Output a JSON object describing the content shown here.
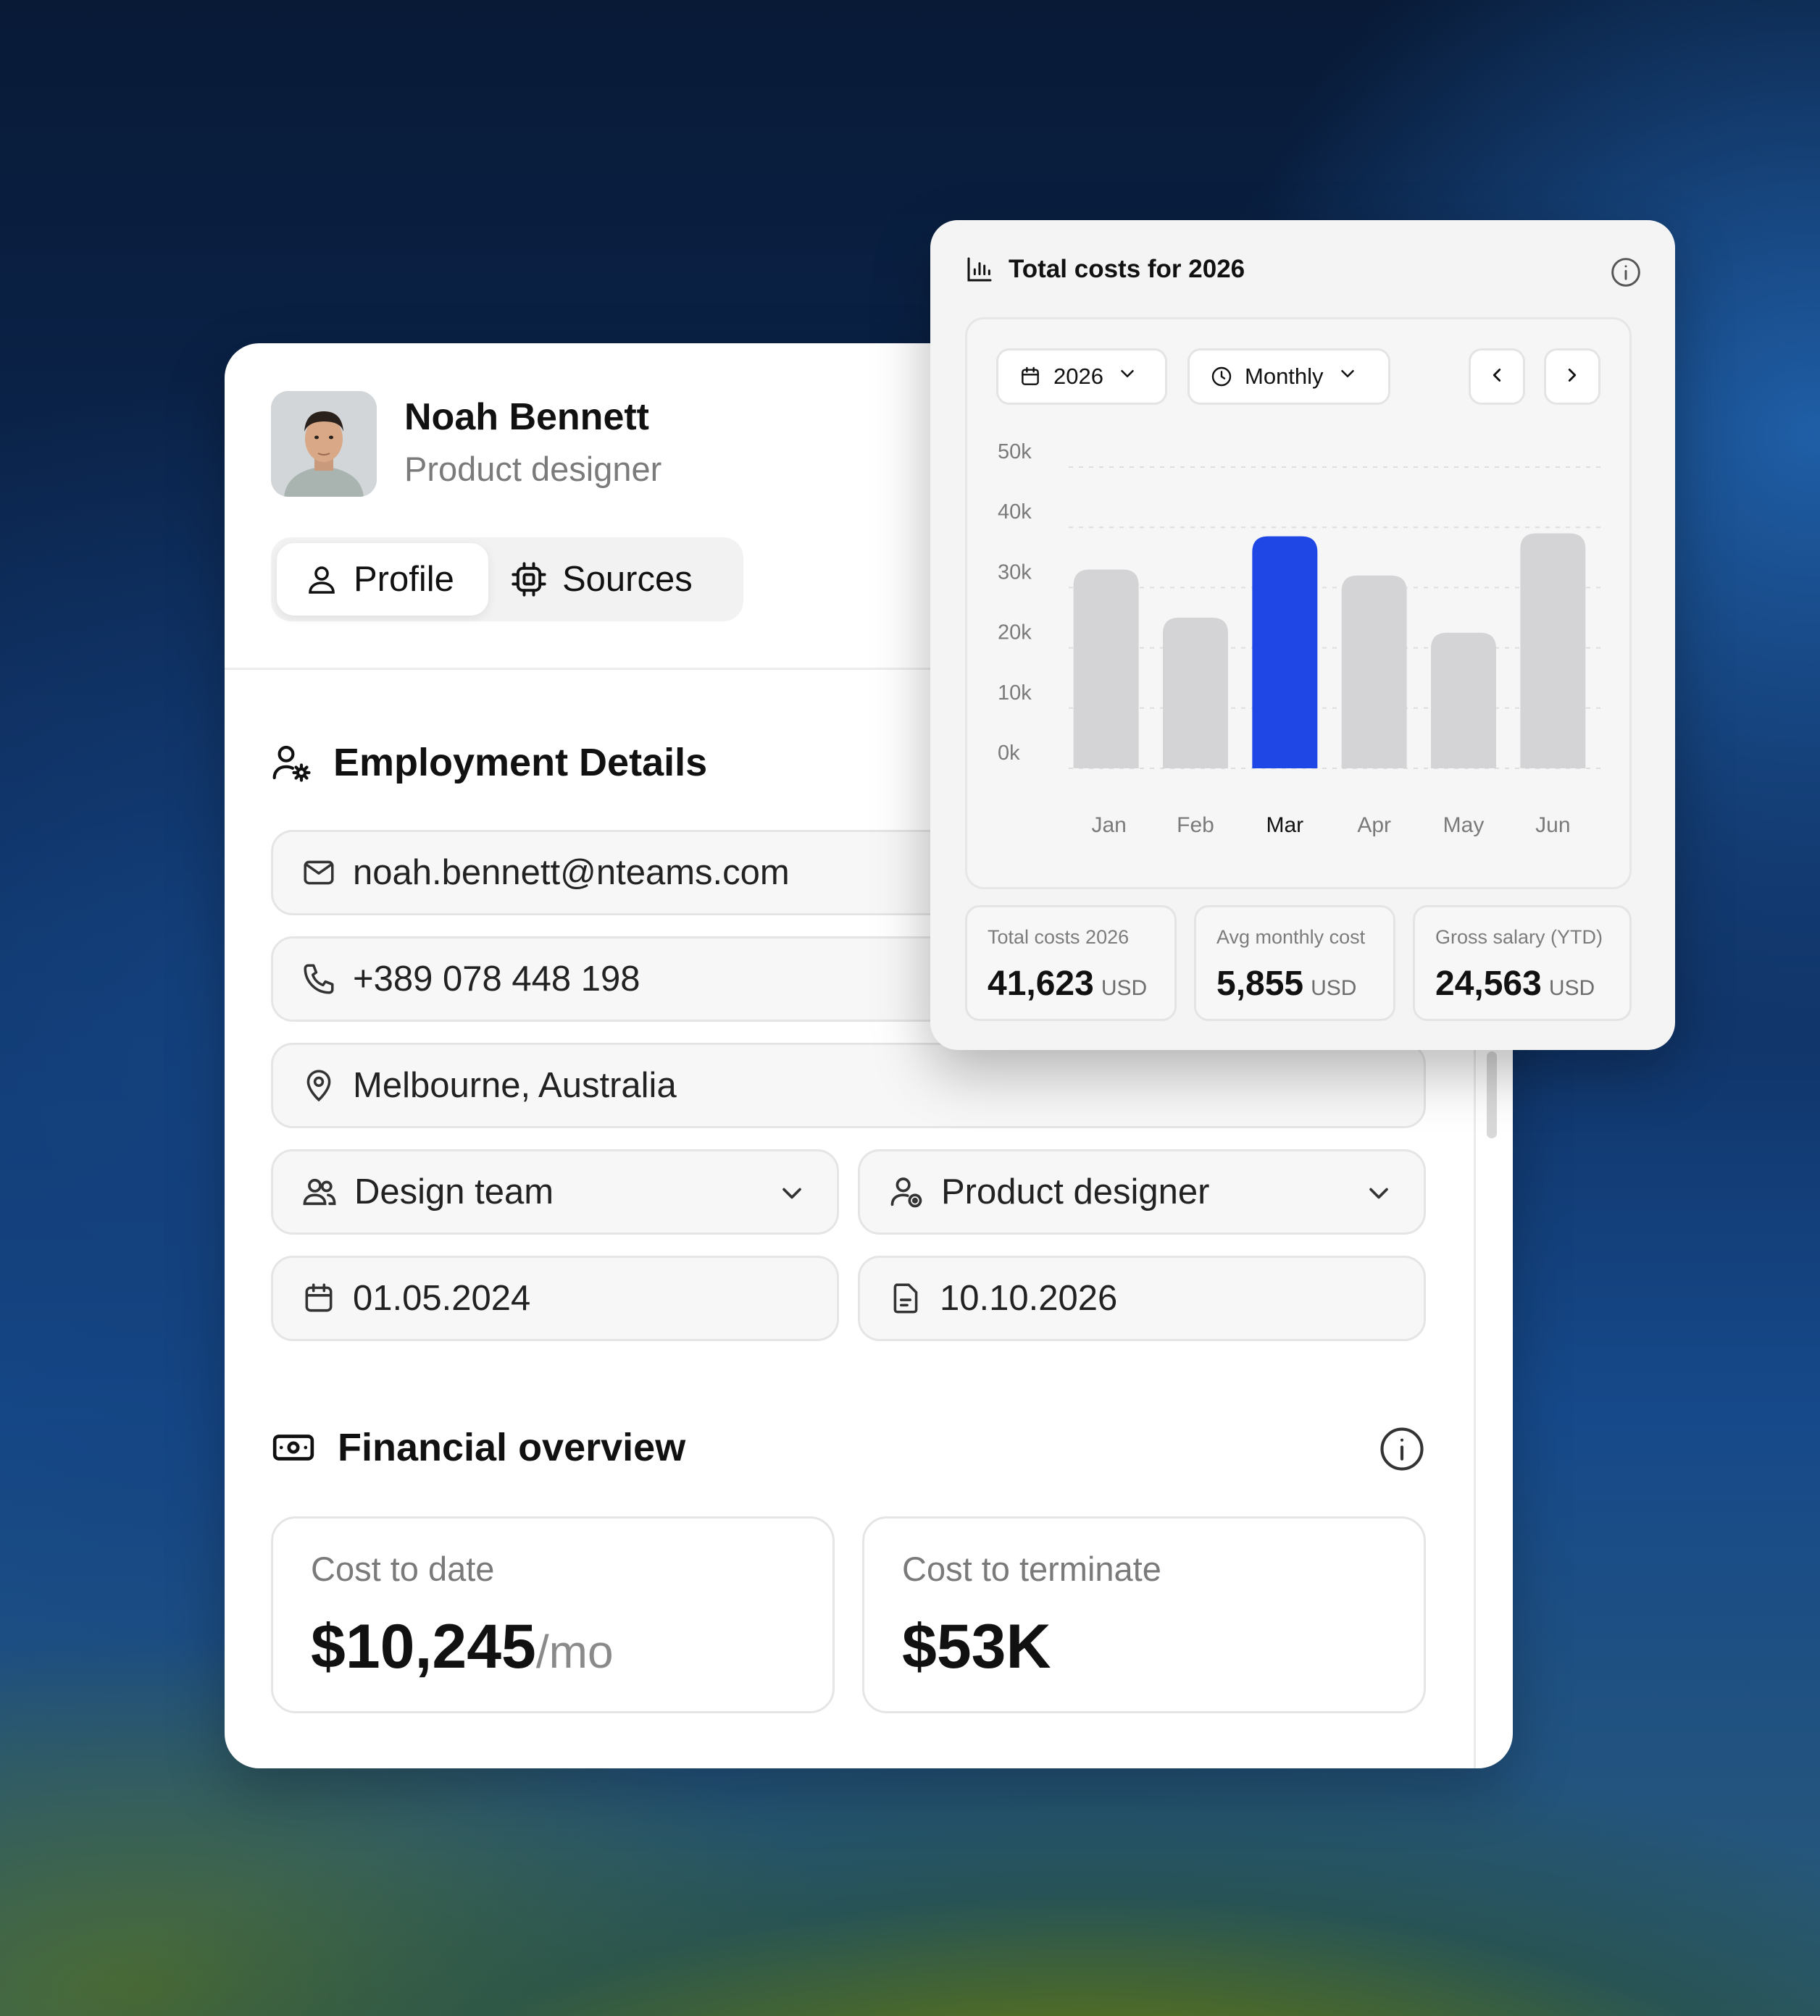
{
  "profile": {
    "name": "Noah Bennett",
    "role": "Product designer",
    "tabs": [
      {
        "label": "Profile",
        "active": true,
        "icon": "user-icon"
      },
      {
        "label": "Sources",
        "active": false,
        "icon": "chip-icon"
      }
    ]
  },
  "employment": {
    "title": "Employment Details",
    "email": "noah.bennett@nteams.com",
    "phone": "+389 078 448 198",
    "location": "Melbourne, Australia",
    "team": "Design team",
    "position": "Product designer",
    "start_date": "01.05.2024",
    "end_date": "10.10.2026"
  },
  "financial": {
    "title": "Financial overview",
    "cost_to_date": {
      "label": "Cost to date",
      "value": "$10,245",
      "suffix": "/mo"
    },
    "cost_to_terminate": {
      "label": "Cost to terminate",
      "value": "$53K"
    }
  },
  "costs_widget": {
    "title": "Total costs for 2026",
    "year_select": "2026",
    "period_select": "Monthly",
    "stats": [
      {
        "label": "Total costs 2026",
        "value": "41,623",
        "unit": "USD"
      },
      {
        "label": "Avg monthly cost",
        "value": "5,855",
        "unit": "USD"
      },
      {
        "label": "Gross salary (YTD)",
        "value": "24,563",
        "unit": "USD"
      }
    ]
  },
  "colors": {
    "accent": "#1f47e6",
    "bar": "#d4d4d6"
  },
  "chart_data": {
    "type": "bar",
    "categories": [
      "Jan",
      "Feb",
      "Mar",
      "Apr",
      "May",
      "Jun"
    ],
    "values": [
      33000,
      25000,
      38500,
      32000,
      22500,
      39000
    ],
    "highlighted": "Mar",
    "yticks": [
      "50k",
      "40k",
      "30k",
      "20k",
      "10k",
      "0k"
    ],
    "ylim": [
      0,
      50000
    ],
    "grid": true
  }
}
